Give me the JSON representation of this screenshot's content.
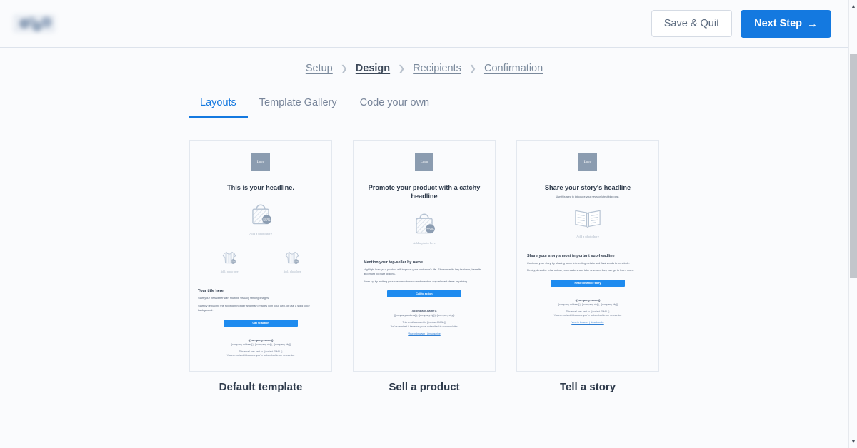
{
  "header": {
    "logo_alt": "company-logo",
    "save_quit_label": "Save & Quit",
    "next_step_label": "Next Step",
    "next_step_arrow": "→"
  },
  "breadcrumb": {
    "separator": "❯",
    "steps": [
      {
        "label": "Setup",
        "active": false
      },
      {
        "label": "Design",
        "active": true
      },
      {
        "label": "Recipients",
        "active": false
      },
      {
        "label": "Confirmation",
        "active": false
      }
    ]
  },
  "tabs": [
    {
      "label": "Layouts",
      "active": true
    },
    {
      "label": "Template Gallery",
      "active": false
    },
    {
      "label": "Code your own",
      "active": false
    }
  ],
  "common": {
    "logo_placeholder": "Logo",
    "photo_label": "Add a photo here",
    "footer_company": "{{company.name}}",
    "footer_address": "{{company.address}}, {{company.zip}}, {{company.city}}",
    "footer_sent": "This email was sent to {{contact.EMAIL}}",
    "footer_subscribed": "You've received it because you've subscribed to our newsletter.",
    "footer_links": "View in browser | Unsubscribe",
    "badge_text": "55%"
  },
  "templates": [
    {
      "name": "Default template",
      "headline": "This is your headline.",
      "subheadline": "",
      "hero_icon": "shopping-bag-icon",
      "extra_photos": 2,
      "extra_photo_icon": "tshirt-icon",
      "body_title": "Your title here",
      "body_paragraphs": [
        "Start your newsletter with multiple visually striking images.",
        "Start by replacing the full-width header and main images with your own, or use a solid color background."
      ],
      "cta_label": "Call to action",
      "has_footer_links": false
    },
    {
      "name": "Sell a product",
      "headline": "Promote your product with a catchy headline",
      "subheadline": "",
      "hero_icon": "shopping-bag-icon",
      "extra_photos": 0,
      "extra_photo_icon": "",
      "body_title": "Mention your top-seller by name",
      "body_paragraphs": [
        "Highlight how your product will improve your customer's life. Showcase its key features, benefits and most popular options.",
        "Wrap up by inviting your customer to shop and mention any relevant deals or pricing."
      ],
      "cta_label": "Call to action",
      "has_footer_links": true
    },
    {
      "name": "Tell a story",
      "headline": "Share your story's headline",
      "subheadline": "Use this area to introduce your news or latest blog post.",
      "hero_icon": "open-book-icon",
      "extra_photos": 0,
      "extra_photo_icon": "",
      "body_title": "Share your story's most important sub-headline",
      "body_paragraphs": [
        "Continue your story by sharing some interesting details and final words to conclude.",
        "Finally, describe what action your readers can take or where they can go to learn more."
      ],
      "cta_label": "Read the whole story",
      "has_footer_links": true
    }
  ],
  "scrollbar": {
    "up_arrow": "▲",
    "down_arrow": "▼"
  },
  "colors": {
    "accent": "#1479e0",
    "cta": "#1e8bef",
    "page_bg": "#fafbfd",
    "text": "#2f3b4c"
  }
}
